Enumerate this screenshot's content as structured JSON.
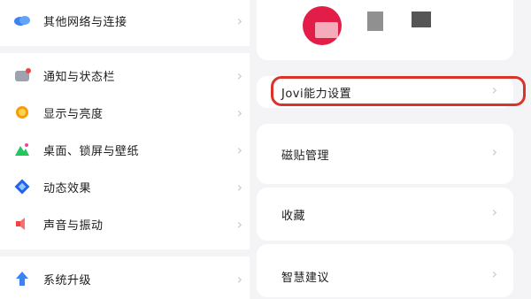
{
  "left_menu": {
    "items": [
      {
        "label": "其他网络与连接",
        "icon": "cloud-icon"
      },
      {
        "label": "通知与状态栏",
        "icon": "notification-icon"
      },
      {
        "label": "显示与亮度",
        "icon": "brightness-icon"
      },
      {
        "label": "桌面、锁屏与壁纸",
        "icon": "wallpaper-icon"
      },
      {
        "label": "动态效果",
        "icon": "motion-icon"
      },
      {
        "label": "声音与振动",
        "icon": "sound-icon"
      },
      {
        "label": "系统升级",
        "icon": "upgrade-icon"
      }
    ]
  },
  "right_panel": {
    "items": [
      {
        "label": "Jovi能力设置"
      },
      {
        "label": "磁贴管理"
      },
      {
        "label": "收藏"
      },
      {
        "label": "智慧建议"
      }
    ],
    "highlight_color": "#d9342b"
  }
}
